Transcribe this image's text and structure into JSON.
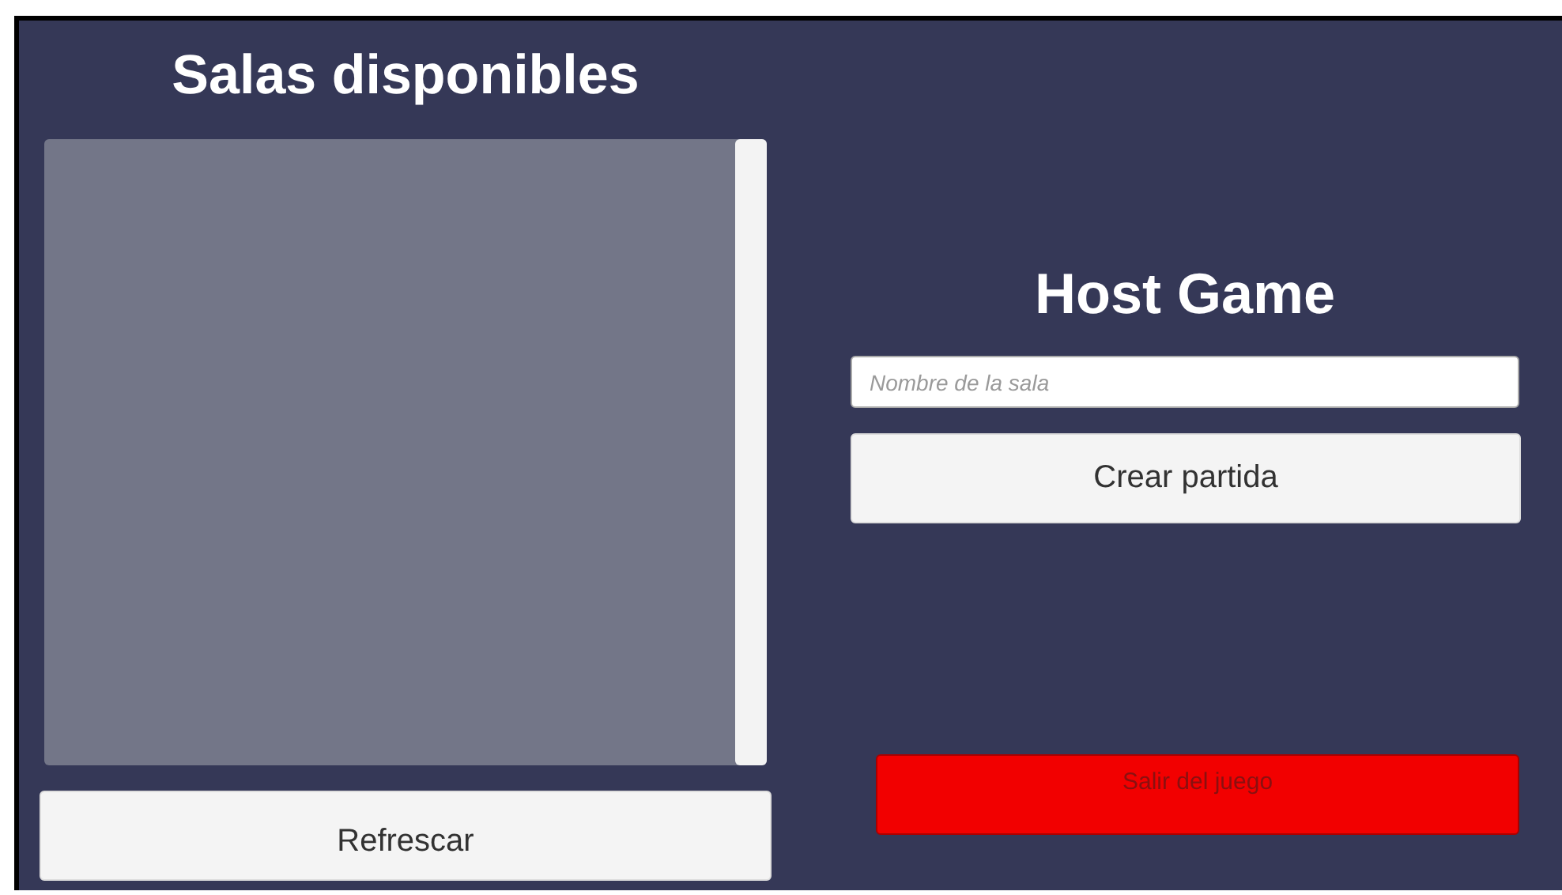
{
  "rooms_panel": {
    "title": "Salas disponibles",
    "refresh_button": "Refrescar"
  },
  "host_panel": {
    "title": "Host Game",
    "room_name_field": {
      "placeholder": "Nombre de la sala"
    },
    "create_button": "Crear partida"
  },
  "quit_button": "Salir del juego"
}
